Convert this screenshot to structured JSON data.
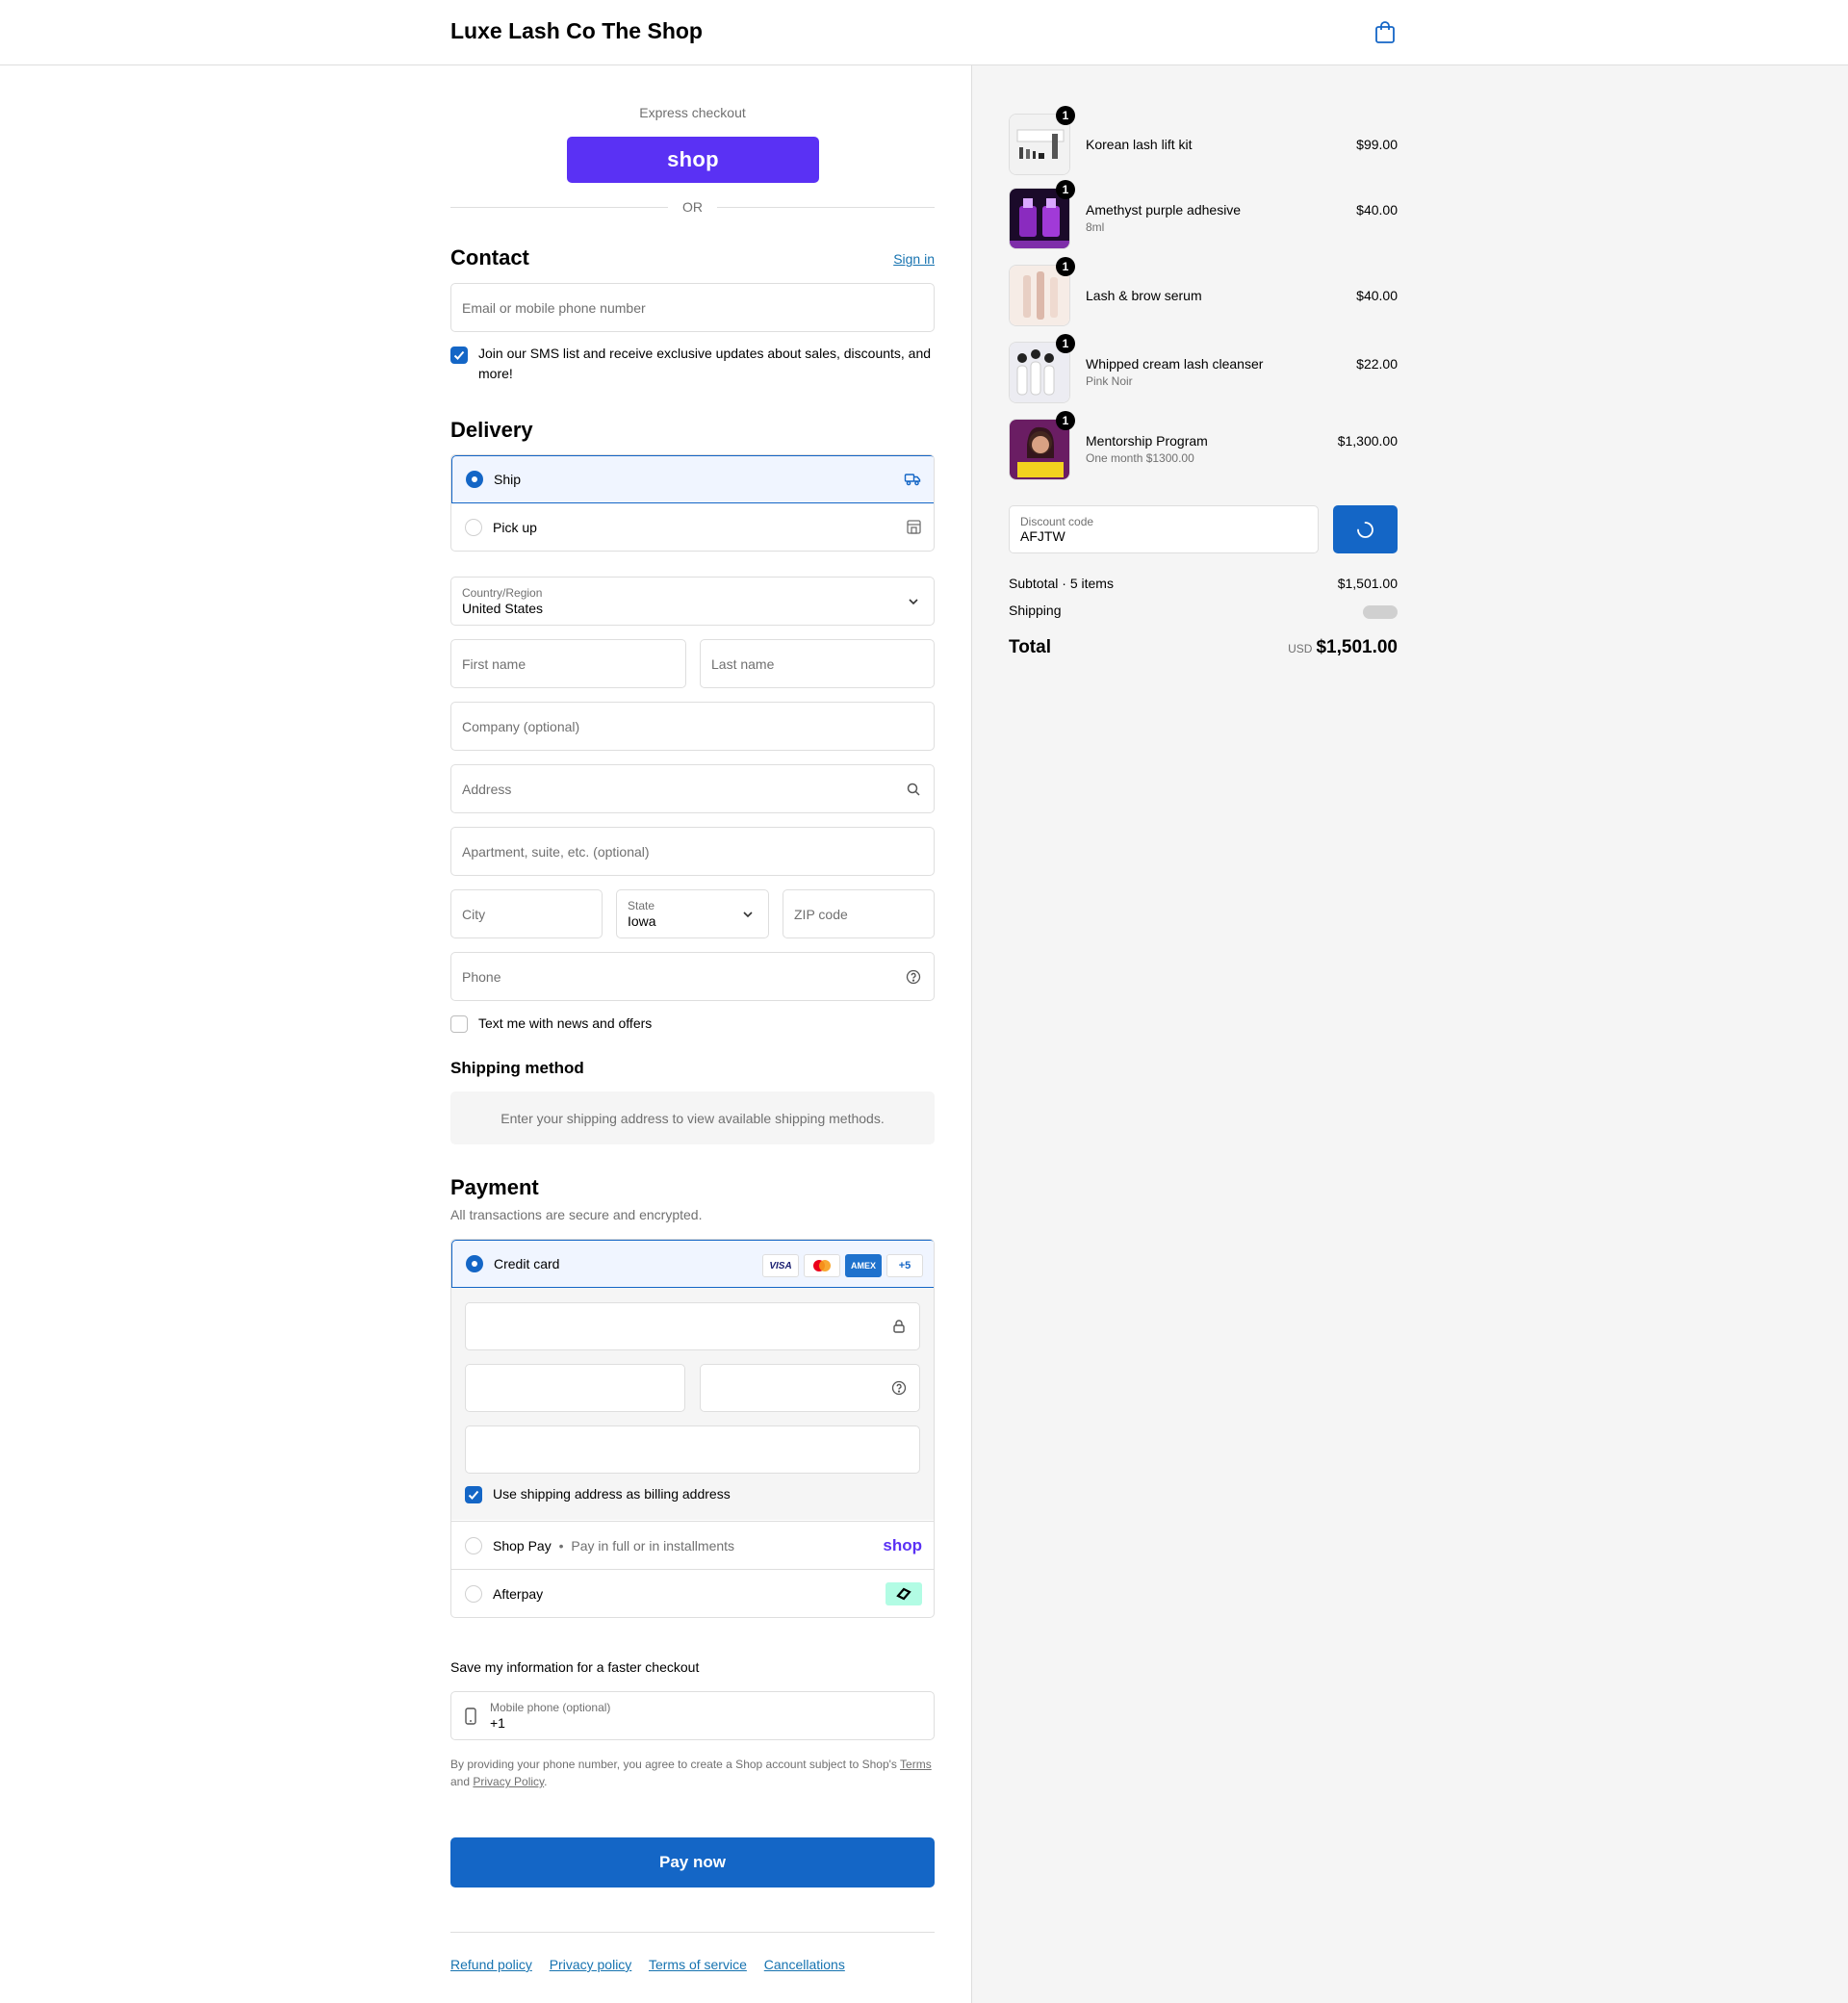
{
  "header": {
    "brand": "Luxe Lash Co The Shop",
    "cart_icon": "shopping-bag-icon"
  },
  "express": {
    "label": "Express checkout",
    "shop_button": "shop",
    "or": "OR"
  },
  "contact": {
    "heading": "Contact",
    "sign_in": "Sign in",
    "email_placeholder": "Email or mobile phone number",
    "sms_opt_in": "Join our SMS list and receive exclusive updates about sales, discounts, and",
    "sms_opt_in_cont": "more!",
    "sms_checked": true
  },
  "delivery": {
    "heading": "Delivery",
    "options": [
      {
        "label": "Ship",
        "selected": true,
        "icon": "truck-icon"
      },
      {
        "label": "Pick up",
        "selected": false,
        "icon": "store-icon"
      }
    ],
    "country_label": "Country/Region",
    "country_value": "United States",
    "first_name": "First name",
    "last_name": "Last name",
    "company": "Company (optional)",
    "address": "Address",
    "apartment": "Apartment, suite, etc. (optional)",
    "city": "City",
    "state_label": "State",
    "state_value": "Iowa",
    "zip": "ZIP code",
    "phone": "Phone",
    "text_offers": "Text me with news and offers"
  },
  "shipping_method": {
    "heading": "Shipping method",
    "message": "Enter your shipping address to view available shipping methods."
  },
  "payment": {
    "heading": "Payment",
    "subtitle": "All transactions are secure and encrypted.",
    "credit_card": "Credit card",
    "card_logos": [
      "VISA",
      "",
      "AMEX",
      "+5"
    ],
    "billing_same": "Use shipping address as billing address",
    "shop_pay": "Shop Pay",
    "shop_pay_sep": "•",
    "shop_pay_sub": "Pay in full or in installments",
    "shop_pay_logo": "shop",
    "afterpay": "Afterpay",
    "colors": {
      "accent": "#1466c6",
      "shop": "#5a31f4",
      "afterpay": "#b2fce4"
    }
  },
  "save_info": {
    "heading": "Save my information for a faster checkout",
    "mobile_label": "Mobile phone (optional)",
    "mobile_value": "+1",
    "legal_1": "By providing your phone number, you agree to create a Shop account subject to Shop's",
    "terms": "Terms",
    "legal_and": "and",
    "privacy": "Privacy Policy",
    "legal_end": "."
  },
  "pay_now": "Pay now",
  "footer_links": [
    "Refund policy",
    "Privacy policy",
    "Terms of service",
    "Cancellations"
  ],
  "order": {
    "items": [
      {
        "name": "Korean lash lift kit",
        "variant": "",
        "price": "$99.00",
        "qty": "1"
      },
      {
        "name": "Amethyst purple adhesive",
        "variant": "8ml",
        "price": "$40.00",
        "qty": "1"
      },
      {
        "name": "Lash & brow serum",
        "variant": "",
        "price": "$40.00",
        "qty": "1"
      },
      {
        "name": "Whipped cream lash cleanser",
        "variant": "Pink Noir",
        "price": "$22.00",
        "qty": "1"
      },
      {
        "name": "Mentorship Program",
        "variant": "One month $1300.00",
        "price": "$1,300.00",
        "qty": "1"
      }
    ],
    "discount_label": "Discount code",
    "discount_value": "AFJTW",
    "subtotal_label": "Subtotal · 5 items",
    "subtotal": "$1,501.00",
    "shipping_label": "Shipping",
    "total_label": "Total",
    "currency": "USD",
    "total": "$1,501.00"
  }
}
